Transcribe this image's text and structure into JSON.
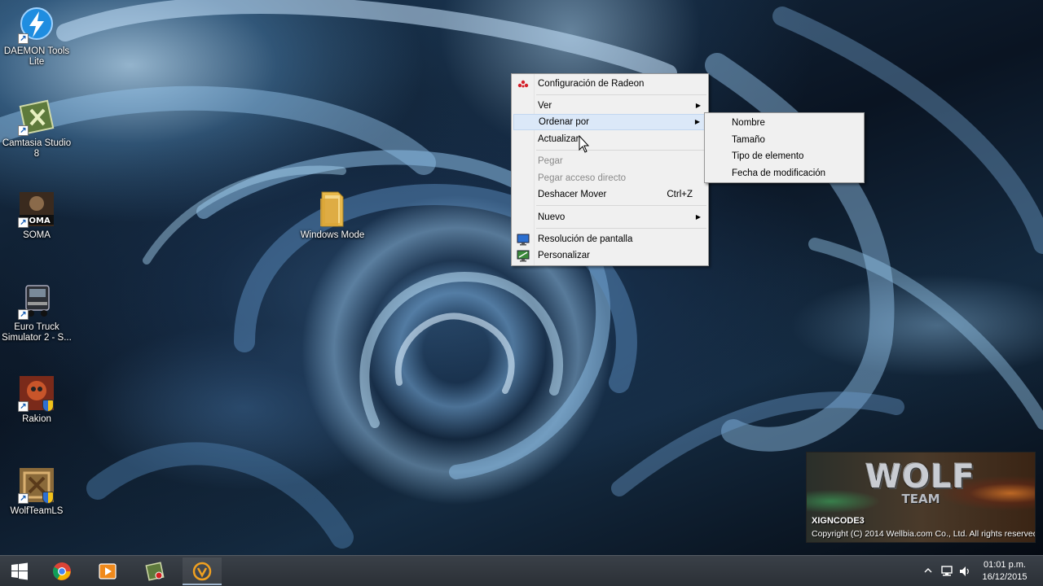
{
  "desktop": {
    "icons": [
      {
        "label": "DAEMON Tools Lite",
        "icon": "daemon-tools-icon"
      },
      {
        "label": "Camtasia Studio 8",
        "icon": "camtasia-icon"
      },
      {
        "label": "SOMA",
        "icon": "soma-icon"
      },
      {
        "label": "Euro Truck Simulator 2 - S...",
        "icon": "euro-truck-icon"
      },
      {
        "label": "Rakion",
        "icon": "rakion-icon"
      },
      {
        "label": "WolfTeamLS",
        "icon": "wolfteam-icon"
      },
      {
        "label": "Windows Mode",
        "icon": "folder-icon"
      }
    ]
  },
  "context_menu": {
    "items": [
      {
        "label": "Configuración de Radeon",
        "icon": "radeon-icon"
      },
      {
        "label": "Ver",
        "has_submenu": true
      },
      {
        "label": "Ordenar por",
        "has_submenu": true,
        "selected": true
      },
      {
        "label": "Actualizar"
      },
      {
        "label": "Pegar",
        "disabled": true
      },
      {
        "label": "Pegar acceso directo",
        "disabled": true
      },
      {
        "label": "Deshacer Mover",
        "shortcut": "Ctrl+Z"
      },
      {
        "label": "Nuevo",
        "has_submenu": true
      },
      {
        "label": "Resolución de pantalla",
        "icon": "display-icon"
      },
      {
        "label": "Personalizar",
        "icon": "personalize-icon"
      }
    ]
  },
  "sort_submenu": {
    "items": [
      "Nombre",
      "Tamaño",
      "Tipo de elemento",
      "Fecha de modificación"
    ]
  },
  "splash": {
    "logo_text": "WOLF",
    "logo_sub": "TEAM",
    "title": "XIGNCODE3",
    "copyright": "Copyright (C) 2014 Wellbia.com Co., Ltd. All rights reserved."
  },
  "taskbar": {
    "buttons": [
      "windows-start-icon",
      "chrome-icon",
      "media-player-icon",
      "camtasia-recorder-icon",
      "wolfteam-launcher-icon"
    ],
    "active_index": 4,
    "clock": {
      "time": "01:01 p.m.",
      "date": "16/12/2015"
    }
  },
  "colors": {
    "menu_bg": "#f0f0f0",
    "menu_selected": "#dbe8f8",
    "taskbar": "#2b3036"
  }
}
